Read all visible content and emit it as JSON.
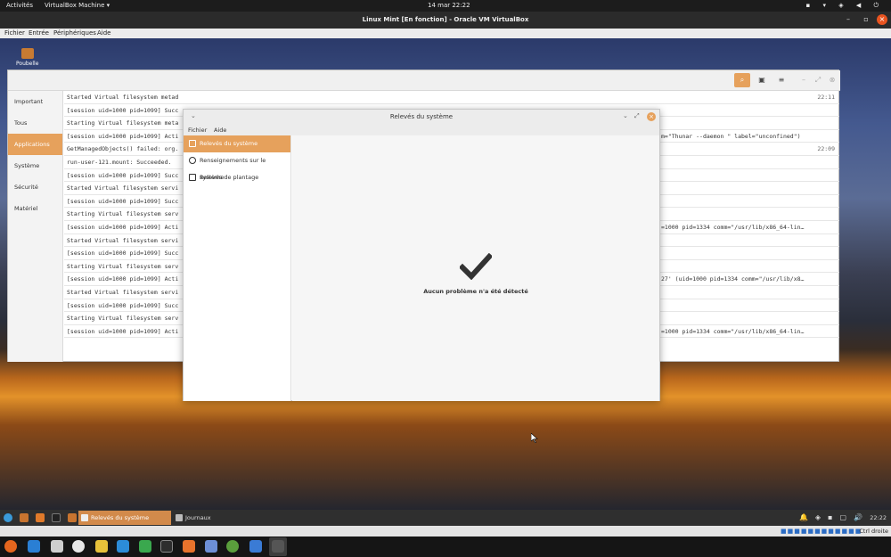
{
  "gnome_bar": {
    "activities": "Activités",
    "app_menu": "VirtualBox Machine ▾",
    "clock": "14 mar  22:22"
  },
  "vbox": {
    "title": "Linux Mint [En fonction] - Oracle VM VirtualBox",
    "menu": [
      "Fichier",
      "Entrée",
      "Périphériques",
      "Aide"
    ],
    "host_key": "Ctrl droite"
  },
  "desktop": {
    "icon_label": "Poubelle"
  },
  "log_viewer": {
    "sidebar": [
      "Important",
      "Tous",
      "Applications",
      "Système",
      "Sécurité",
      "Matériel"
    ],
    "selected": 2,
    "rows": [
      {
        "text": "Started Virtual filesystem metad",
        "time": "22:11",
        "right": ""
      },
      {
        "text": "[session uid=1000 pid=1099] Succ",
        "time": "",
        "right": ""
      },
      {
        "text": "Starting Virtual filesystem meta",
        "time": "",
        "right": ""
      },
      {
        "text": "[session uid=1000 pid=1099] Acti",
        "time": "",
        "right": "m=\"Thunar --daemon \" label=\"unconfined\")"
      },
      {
        "text": "GetManagedObjects() failed: org.",
        "time": "22:09",
        "right": ""
      },
      {
        "text": "run-user-121.mount: Succeeded.",
        "time": "",
        "right": ""
      },
      {
        "text": "[session uid=1000 pid=1099] Succ",
        "time": "",
        "right": ""
      },
      {
        "text": "Started Virtual filesystem servi",
        "time": "",
        "right": ""
      },
      {
        "text": "[session uid=1000 pid=1099] Succ",
        "time": "",
        "right": ""
      },
      {
        "text": "Starting Virtual filesystem serv",
        "time": "",
        "right": ""
      },
      {
        "text": "[session uid=1000 pid=1099] Acti",
        "time": "",
        "right": "=1000 pid=1334 comm=\"/usr/lib/x86_64-lin…"
      },
      {
        "text": "Started Virtual filesystem servi",
        "time": "",
        "right": ""
      },
      {
        "text": "[session uid=1000 pid=1099] Succ",
        "time": "",
        "right": ""
      },
      {
        "text": "Starting Virtual filesystem serv",
        "time": "",
        "right": ""
      },
      {
        "text": "[session uid=1000 pid=1099] Acti",
        "time": "",
        "right": "27' (uid=1000 pid=1334 comm=\"/usr/lib/x8…"
      },
      {
        "text": "Started Virtual filesystem servi",
        "time": "",
        "right": ""
      },
      {
        "text": "[session uid=1000 pid=1099] Succ",
        "time": "",
        "right": ""
      },
      {
        "text": "Starting Virtual filesystem serv",
        "time": "",
        "right": ""
      },
      {
        "text": "[session uid=1000 pid=1099] Acti",
        "time": "",
        "right": "=1000 pid=1334 comm=\"/usr/lib/x86_64-lin…"
      }
    ]
  },
  "dialog": {
    "title": "Relevés du système",
    "menu": [
      "Fichier",
      "Aide"
    ],
    "sidebar": [
      "Relevés du système",
      "Renseignements sur le système",
      "Relevés de plantage"
    ],
    "message": "Aucun problème n'a été détecté"
  },
  "panel": {
    "tasks": [
      {
        "label": "Relevés du système",
        "active": true
      },
      {
        "label": "Journaux",
        "active": false
      }
    ],
    "clock": "22:22"
  },
  "colors": {
    "accent": "#e6a15c",
    "ubuntu_orange": "#e95420"
  }
}
